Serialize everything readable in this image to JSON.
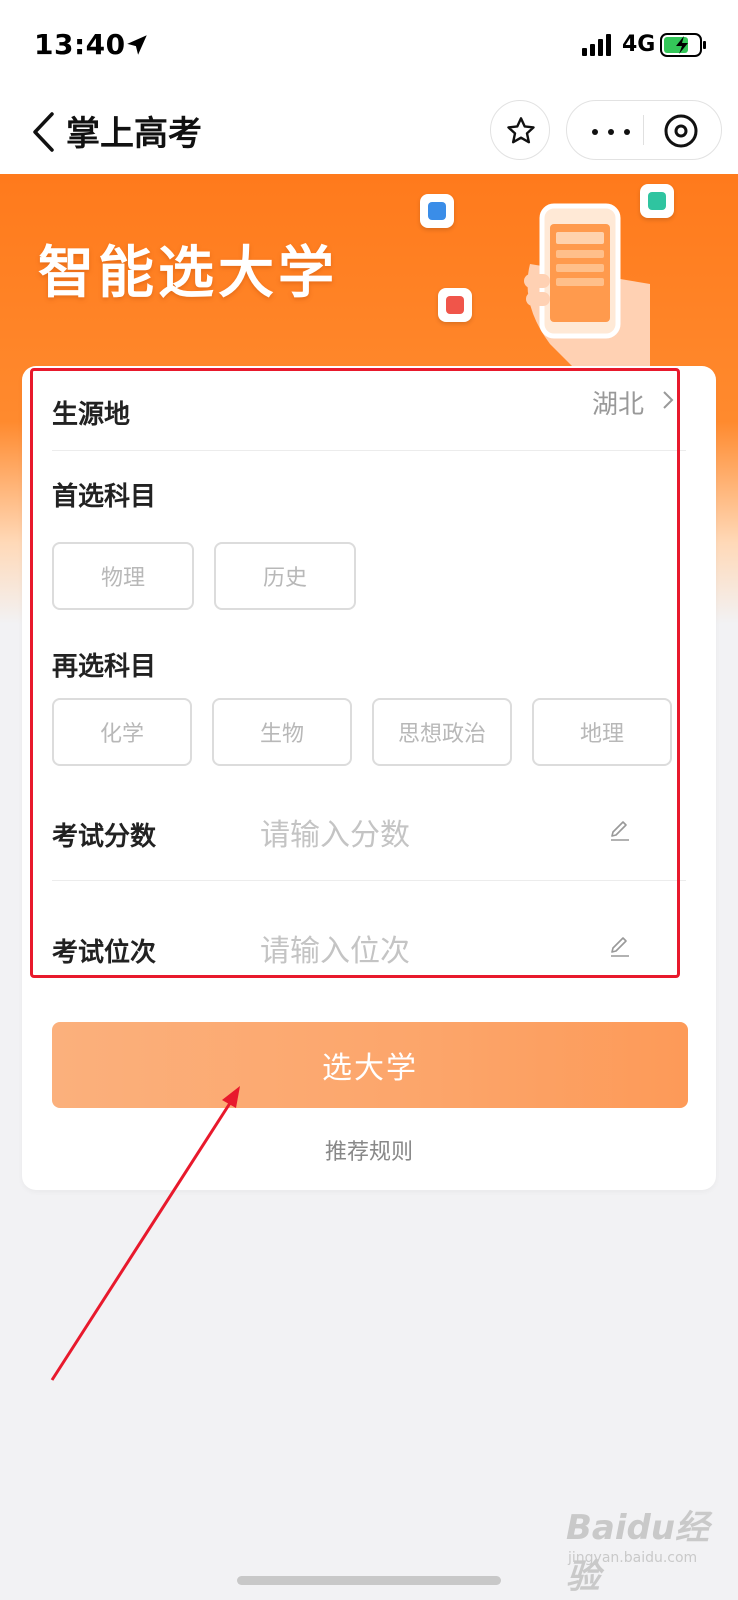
{
  "status_bar": {
    "time": "13:40",
    "network": "4G"
  },
  "nav": {
    "title": "掌上高考"
  },
  "banner": {
    "title": "智能选大学"
  },
  "form": {
    "origin_label": "生源地",
    "origin_value": "湖北",
    "first_subject_label": "首选科目",
    "first_subjects": [
      "物理",
      "历史"
    ],
    "second_subject_label": "再选科目",
    "second_subjects": [
      "化学",
      "生物",
      "思想政治",
      "地理"
    ],
    "score_label": "考试分数",
    "score_placeholder": "请输入分数",
    "rank_label": "考试位次",
    "rank_placeholder": "请输入位次",
    "submit_label": "选大学",
    "rules_link": "推荐规则"
  },
  "watermark": {
    "text": "Baidu经验",
    "sub": "jingyan.baidu.com"
  },
  "colors": {
    "accent_orange": "#ff7a1c",
    "button": "#fca56a",
    "annotation_red": "#e8192c"
  }
}
